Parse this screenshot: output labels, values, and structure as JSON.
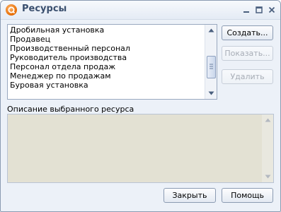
{
  "window": {
    "title": "Ресурсы"
  },
  "resources": {
    "items": [
      "Дробильная установка",
      "Продавец",
      "Производственный персонал",
      "Руководитель производства",
      "Персонал отдела продаж",
      "Менеджер по продажам",
      "Буровая установка"
    ]
  },
  "actions": {
    "create": "Создать...",
    "show": "Показать...",
    "delete": "Удалить"
  },
  "description": {
    "label": "Описание выбранного ресурса",
    "text": ""
  },
  "footer": {
    "close": "Закрыть",
    "help": "Помощь"
  }
}
